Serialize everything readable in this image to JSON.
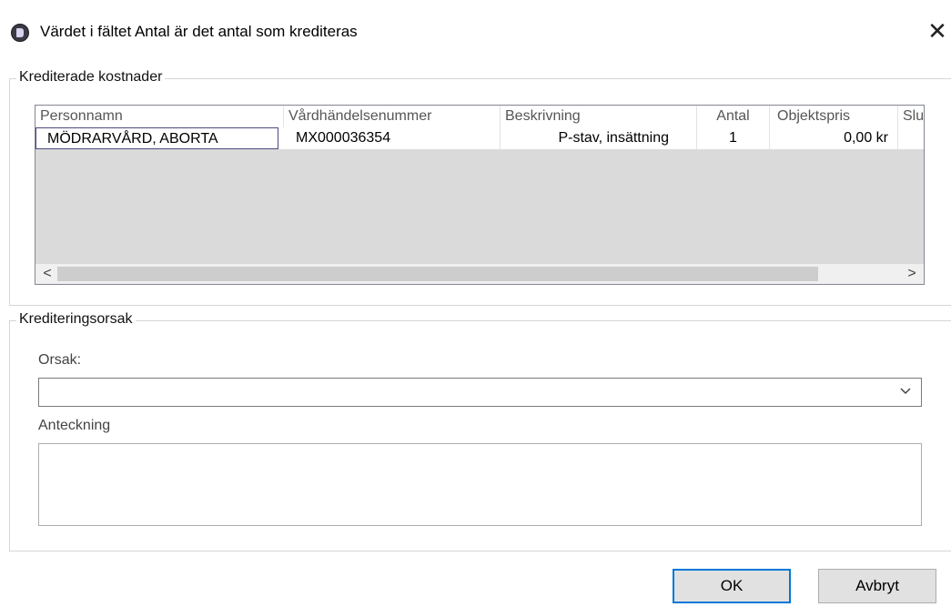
{
  "window": {
    "title": "Värdet i fältet Antal är det antal som krediteras",
    "close_glyph": "✕"
  },
  "credited_costs": {
    "legend": "Krediterade kostnader",
    "columns": [
      "Personnamn",
      "Vårdhändelsenummer",
      "Beskrivning",
      "Antal",
      "Objektspris",
      "Slu"
    ],
    "rows": [
      [
        "MÖDRARVÅRD, ABORTA",
        "MX000036354",
        "P-stav, insättning",
        "1",
        "0,00 kr",
        ""
      ]
    ],
    "scroll_left": "<",
    "scroll_right": ">"
  },
  "credit_reason": {
    "legend": "Krediteringsorsak",
    "reason_label": "Orsak:",
    "reason_value": "",
    "note_label": "Anteckning",
    "note_value": ""
  },
  "buttons": {
    "ok": "OK",
    "cancel": "Avbryt"
  }
}
